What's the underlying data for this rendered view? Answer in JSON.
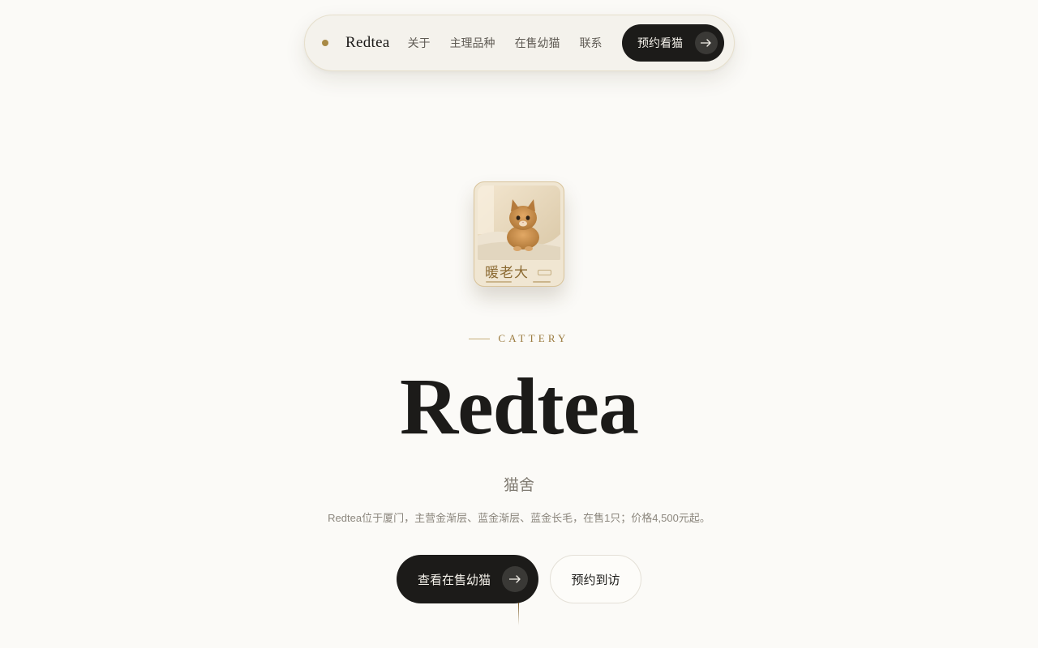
{
  "nav": {
    "brand": "Redtea",
    "links": [
      "关于",
      "主理品种",
      "在售幼猫",
      "联系"
    ],
    "cta_label": "预约看猫",
    "arrow_icon": "arrow-right-icon"
  },
  "card": {
    "name": "暖老大"
  },
  "hero": {
    "eyebrow": "CATTERY",
    "title": "Redtea",
    "subtitle": "猫舍",
    "description": "Redtea位于厦门，主营金渐层、蓝金渐层、蓝金长毛，在售1只；价格4,500元起。",
    "primary_button": "查看在售幼猫",
    "secondary_button": "预约到访"
  },
  "colors": {
    "background": "#fbfaf7",
    "ink": "#1c1b19",
    "gold_accent": "#a88a45"
  }
}
